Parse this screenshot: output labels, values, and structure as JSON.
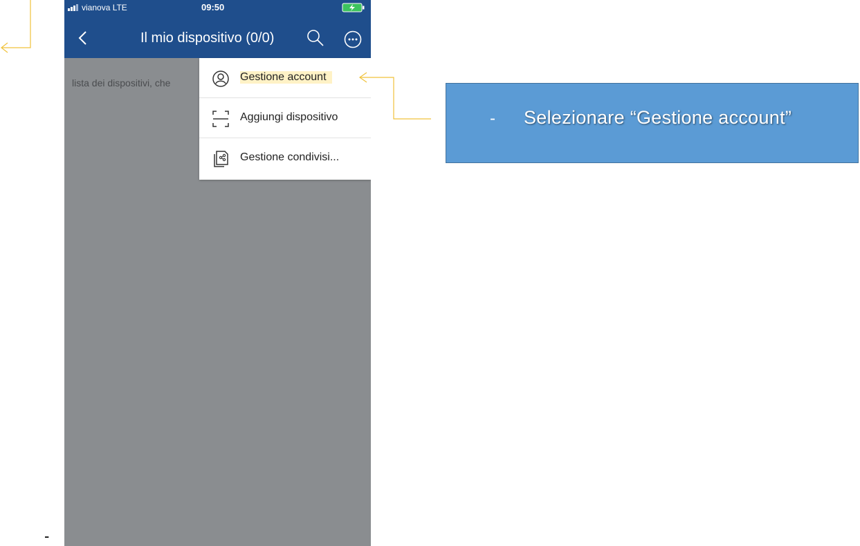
{
  "status_bar": {
    "carrier": "vianova  LTE",
    "time": "09:50",
    "battery_color": "#3cc35e",
    "signal_icon": "signal-bars-icon"
  },
  "nav": {
    "title": "Il mio dispositivo (0/0)",
    "back_icon": "chevron-left-icon",
    "search_icon": "search-icon",
    "more_icon": "more-circle-icon",
    "bar_color": "#1f4e8c"
  },
  "content": {
    "hint_text": "lista dei dispositivi, che"
  },
  "menu": {
    "items": [
      {
        "label": "Gestione account",
        "icon": "account-circle-icon",
        "highlighted": true
      },
      {
        "label": "Aggiungi dispositivo",
        "icon": "scan-frame-icon",
        "highlighted": false
      },
      {
        "label": "Gestione condivisi...",
        "icon": "share-device-icon",
        "highlighted": false
      }
    ]
  },
  "callout": {
    "bullet": "-",
    "text": "Selezionare “Gestione account”",
    "color": "#5b9bd5"
  },
  "connector_color": "#f0c23b",
  "page_mark": "-"
}
